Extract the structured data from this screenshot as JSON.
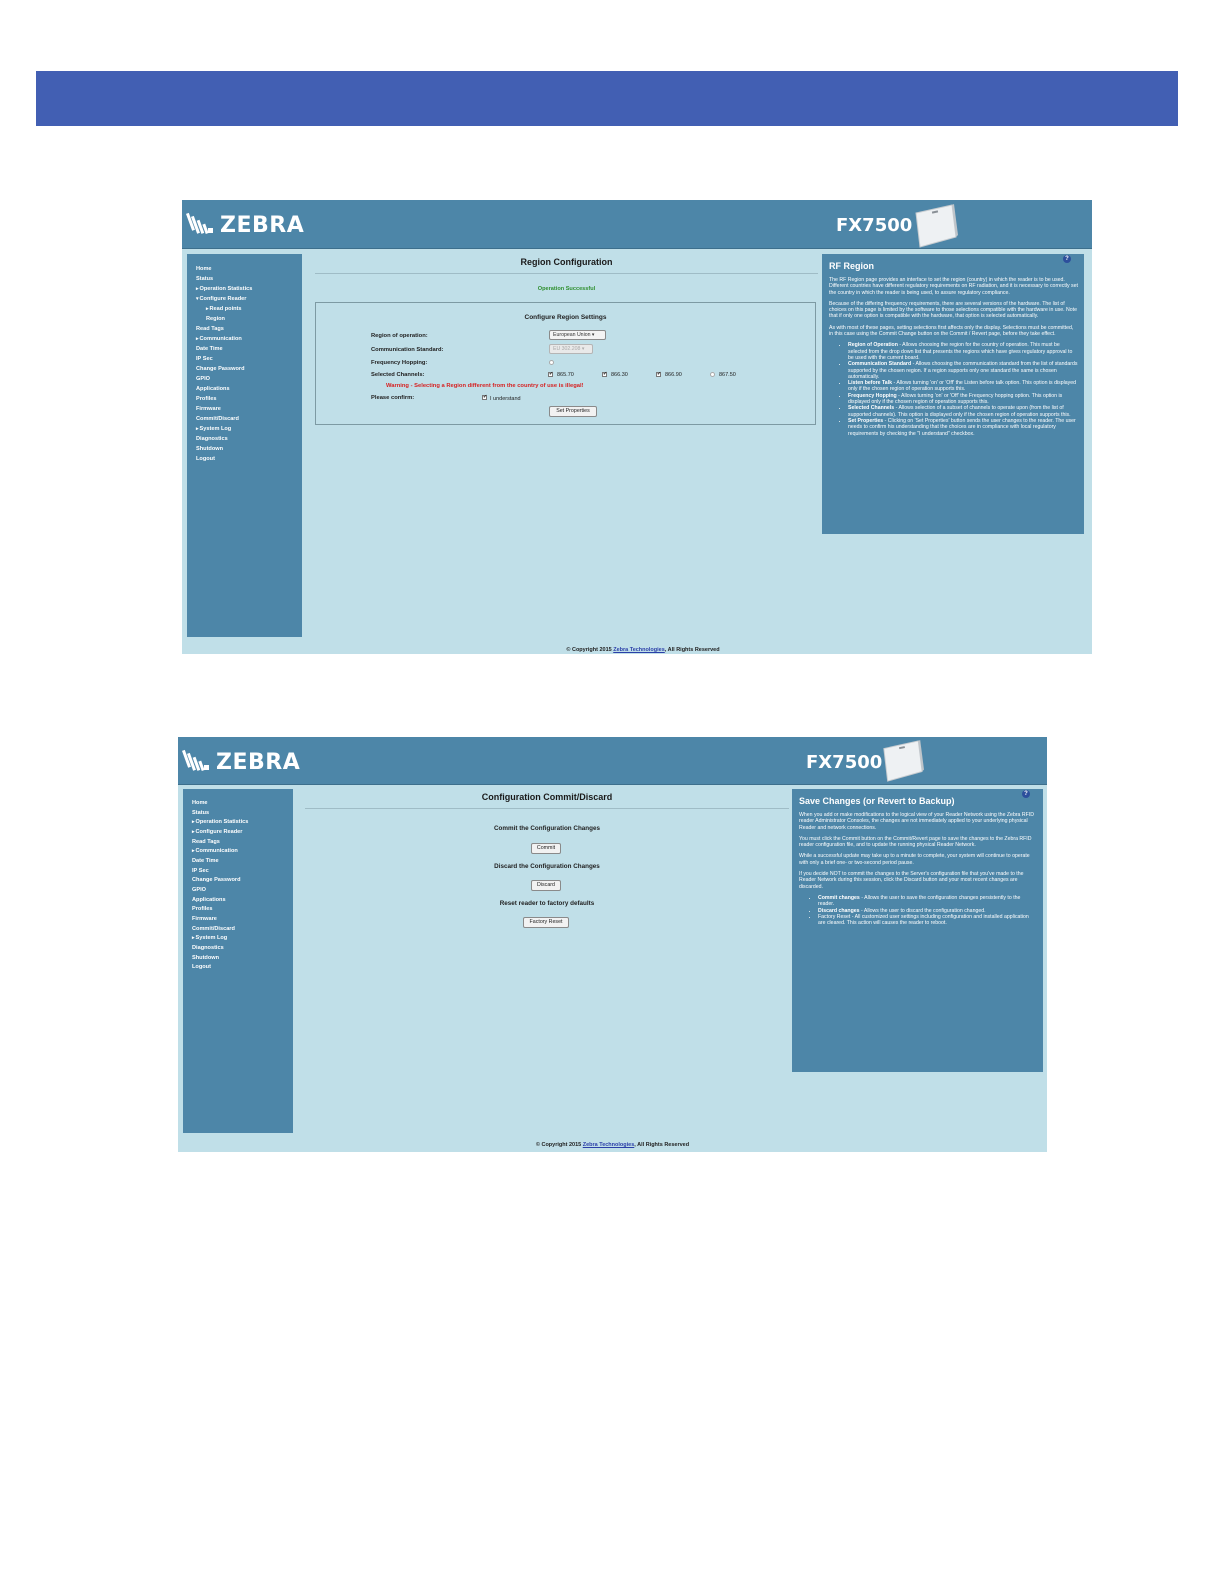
{
  "shot1": {
    "brand": "ZEBRA",
    "product": "FX7500",
    "nav": [
      {
        "label": "Home",
        "arrow": ""
      },
      {
        "label": "Status",
        "arrow": ""
      },
      {
        "label": "Operation Statistics",
        "arrow": "▸"
      },
      {
        "label": "Configure Reader",
        "arrow": "▾"
      },
      {
        "label": "Read points",
        "arrow": "▸",
        "sub": true
      },
      {
        "label": "Region",
        "arrow": "",
        "sub": true
      },
      {
        "label": "Read Tags",
        "arrow": ""
      },
      {
        "label": "Communication",
        "arrow": "▸"
      },
      {
        "label": "Date Time",
        "arrow": ""
      },
      {
        "label": "IP Sec",
        "arrow": ""
      },
      {
        "label": "Change Password",
        "arrow": ""
      },
      {
        "label": "GPIO",
        "arrow": ""
      },
      {
        "label": "Applications",
        "arrow": ""
      },
      {
        "label": "Profiles",
        "arrow": ""
      },
      {
        "label": "Firmware",
        "arrow": ""
      },
      {
        "label": "Commit/Discard",
        "arrow": ""
      },
      {
        "label": "System Log",
        "arrow": "▸"
      },
      {
        "label": "Diagnostics",
        "arrow": ""
      },
      {
        "label": "Shutdown",
        "arrow": ""
      },
      {
        "label": "Logout",
        "arrow": ""
      }
    ],
    "page_title": "Region Configuration",
    "status_message": "Operation Successful",
    "box_title": "Configure Region Settings",
    "labels": {
      "region": "Region of operation:",
      "standard": "Communication Standard:",
      "hopping": "Frequency Hopping:",
      "channels": "Selected Channels:",
      "confirm": "Please confirm:"
    },
    "region_value": "European Union ▾",
    "standard_value": "EU 302.208 ▾",
    "channels": [
      {
        "label": "865.70",
        "checked": true
      },
      {
        "label": "866.30",
        "checked": true
      },
      {
        "label": "866.90",
        "checked": true
      },
      {
        "label": "867.50",
        "checked": false
      }
    ],
    "warning": "Warning - Selecting a Region different from the country of use is illegal!",
    "understand_label": "I understand",
    "set_properties": "Set Properties",
    "help": {
      "qmark": "?",
      "title": "RF Region",
      "p1": "The RF Region page provides an interface to set the region (country) in which the reader is to be used. Different countries have different regulatory requirements on RF radiation, and it is necessary to correctly set the country in which the reader is being used, to assure regulatory compliance.",
      "p2": "Because of the differing frequency requirements, there are several versions of the hardware. The list of choices on this page is limited by the software to those selections compatible with the hardware in use. Note that if only one option is compatible with the hardware, that option is selected automatically.",
      "p3": "As with most of these pages, setting selections first affects only the display. Selections must be committed, in this case using the Commit Change button on the Commit / Revert page, before they take effect.",
      "items": [
        {
          "term": "Region of Operation",
          "text": " - Allows choosing the region for the country of operation. This must be selected from the drop down list that presents the regions which have gives regulatory approval to be used with the current board."
        },
        {
          "term": "Communication Standard",
          "text": " - Allows choosing the communication standard from the list of standards supported by the chosen region. If a region supports only one standard the same is chosen automatically."
        },
        {
          "term": "Listen before Talk",
          "text": " - Allows turning 'on' or 'Off' the Listen before talk option. This option is displayed only if the chosen region of operation supports this."
        },
        {
          "term": "Frequency Hopping",
          "text": " - Allows turning 'on' or 'Off' the Frequency hopping option. This option is displayed only if the chosen region of operation supports this."
        },
        {
          "term": "Selected Channels",
          "text": " - Allows selection of a subset of channels to operate upon (from the list of supported channels). This option is displayed only if the chosen region of operation supports this."
        },
        {
          "term": "Set Properties",
          "text": " - Clicking on 'Set Properties' button sends the user changes to the reader. The user needs to confirm his understanding that the choices are in compliance with local regulatory requirements by checking the \"I understand\" checkbox."
        }
      ]
    },
    "footer_prefix": "© Copyright 2015 ",
    "footer_link": "Zebra Technologies",
    "footer_suffix": ", All Rights Reserved"
  },
  "shot2": {
    "brand": "ZEBRA",
    "product": "FX7500",
    "nav": [
      {
        "label": "Home",
        "arrow": ""
      },
      {
        "label": "Status",
        "arrow": ""
      },
      {
        "label": "Operation Statistics",
        "arrow": "▸"
      },
      {
        "label": "Configure Reader",
        "arrow": "▸"
      },
      {
        "label": "Read Tags",
        "arrow": ""
      },
      {
        "label": "Communication",
        "arrow": "▸"
      },
      {
        "label": "Date Time",
        "arrow": ""
      },
      {
        "label": "IP Sec",
        "arrow": ""
      },
      {
        "label": "Change Password",
        "arrow": ""
      },
      {
        "label": "GPIO",
        "arrow": ""
      },
      {
        "label": "Applications",
        "arrow": ""
      },
      {
        "label": "Profiles",
        "arrow": ""
      },
      {
        "label": "Firmware",
        "arrow": ""
      },
      {
        "label": "Commit/Discard",
        "arrow": ""
      },
      {
        "label": "System Log",
        "arrow": "▸"
      },
      {
        "label": "Diagnostics",
        "arrow": ""
      },
      {
        "label": "Shutdown",
        "arrow": ""
      },
      {
        "label": "Logout",
        "arrow": ""
      }
    ],
    "page_title": "Configuration Commit/Discard",
    "commit_heading": "Commit the Configuration Changes",
    "commit_button": "Commit",
    "discard_heading": "Discard the Configuration Changes",
    "discard_button": "Discard",
    "reset_heading": "Reset reader to factory defaults",
    "reset_button": "Factory Reset",
    "help": {
      "qmark": "?",
      "title": "Save Changes (or Revert to Backup)",
      "p1": "When you add or make modifications to the logical view of your Reader Network using the Zebra RFID reader Administrator Consoles, the changes are not immediately applied to your underlying physical Reader and network connections.",
      "p2": "You must click the Commit button on the Commit/Revert page to save the changes to the Zebra RFID reader configuration file, and to update the running physical Reader Network.",
      "p3": "While a successful update may take up to a minute to complete, your system will continue to operate with only a brief one- or two-second period pause.",
      "p4": "If you decide NOT to commit the changes to the Server's configuration file that you've made to the Reader Network during this session, click the Discard button and your most recent changes are discarded.",
      "items": [
        {
          "term": "Commit changes",
          "text": " - Allows the user to save the configuration changes persistently to the reader."
        },
        {
          "term": "Discard changes",
          "text": " - Allows the user to discard the configuration changed."
        },
        {
          "term": "",
          "text": "Factory Reset - All customized user settings including configuration and installed application are cleared. This action will causes the reader to reboot."
        }
      ]
    },
    "footer_prefix": "© Copyright 2015 ",
    "footer_link": "Zebra Technologies",
    "footer_suffix": ", All Rights Reserved"
  }
}
